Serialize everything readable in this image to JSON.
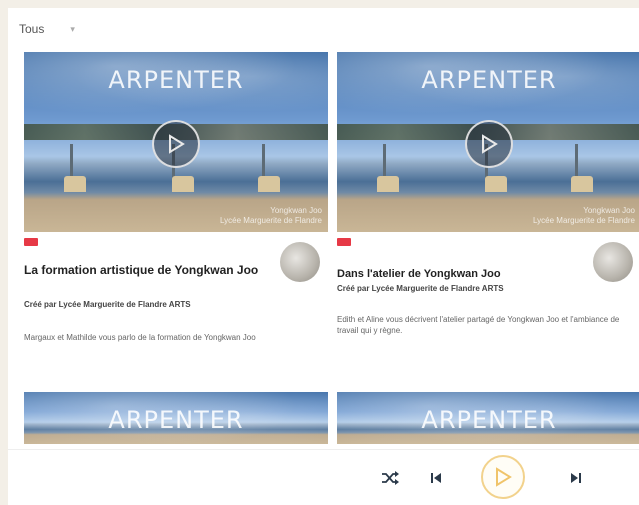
{
  "filter": {
    "label": "Tous"
  },
  "brand": "ARPENTER",
  "cards": [
    {
      "title": "La formation artistique de Yongkwan Joo",
      "byline": "Créé par Lycée Marguerite de Flandre ARTS",
      "description": "Margaux et Mathilde vous parlo de la formation de Yongkwan Joo",
      "watermark_line1": "Yongkwan Joo",
      "watermark_line2": "Lycée Marguerite de Flandre"
    },
    {
      "title": "Dans l'atelier de Yongkwan Joo",
      "byline": "Créé par Lycée Marguerite de Flandre ARTS",
      "description": "Edith et Aline vous décrivent l'atelier partagé de Yongkwan Joo et l'ambiance de travail qui y règne.",
      "watermark_line1": "Yongkwan Joo",
      "watermark_line2": "Lycée Marguerite de Flandre"
    }
  ],
  "colors": {
    "tag": "#e63946",
    "play_ring": "#f2d28c",
    "background": "#f3efe7"
  },
  "player": {
    "icons": [
      "shuffle-icon",
      "skip-previous-icon",
      "play-icon",
      "skip-next-icon"
    ]
  }
}
